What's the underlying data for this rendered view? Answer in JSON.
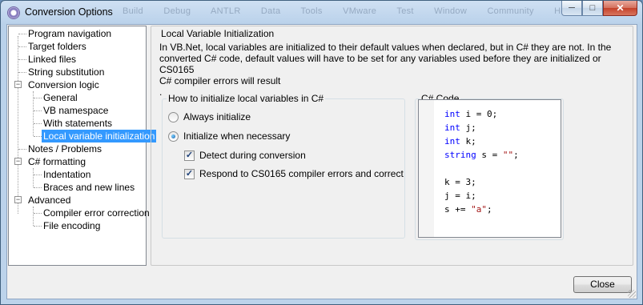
{
  "window": {
    "title": "Conversion Options",
    "background_menu": [
      "Build",
      "Debug",
      "ANTLR",
      "Data",
      "Tools",
      "VMware",
      "Test",
      "Window",
      "Community",
      "Help"
    ]
  },
  "tree": {
    "items": [
      {
        "label": "Program navigation"
      },
      {
        "label": "Target folders"
      },
      {
        "label": "Linked files"
      },
      {
        "label": "String substitution"
      },
      {
        "label": "Conversion logic"
      },
      {
        "label": "General"
      },
      {
        "label": "VB namespace"
      },
      {
        "label": "With statements"
      },
      {
        "label": "Local variable initialization"
      },
      {
        "label": "Notes / Problems"
      },
      {
        "label": "C# formatting"
      },
      {
        "label": "Indentation"
      },
      {
        "label": "Braces and new lines"
      },
      {
        "label": "Advanced"
      },
      {
        "label": "Compiler error correction"
      },
      {
        "label": "File encoding"
      }
    ],
    "selected": "Local variable initialization"
  },
  "panel": {
    "title": "Local Variable Initialization",
    "description_lines": [
      "In VB.Net, local variables are initialized to their default values when declared, but in C# they are not.  In the",
      "converted C# code, default values will have to be set for any variables used before they are initialized or CS0165",
      "C# compiler errors will result",
      "."
    ]
  },
  "init_group": {
    "title": "How to initialize local variables in C#",
    "always_label": "Always initialize",
    "necessary_label": "Initialize when necessary",
    "selected": "Initialize when necessary",
    "detect_label": "Detect during conversion",
    "detect_checked": true,
    "respond_label": "Respond to CS0165 compiler errors and correct",
    "respond_checked": true
  },
  "code_group": {
    "title": "C# Code",
    "lines": [
      [
        {
          "t": "int",
          "c": "kw"
        },
        {
          "t": " i = ",
          "c": ""
        },
        {
          "t": "0",
          "c": "num"
        },
        {
          "t": ";",
          "c": ""
        }
      ],
      [
        {
          "t": "int",
          "c": "kw"
        },
        {
          "t": " j;",
          "c": ""
        }
      ],
      [
        {
          "t": "int",
          "c": "kw"
        },
        {
          "t": " k;",
          "c": ""
        }
      ],
      [
        {
          "t": "string",
          "c": "kw"
        },
        {
          "t": " s = ",
          "c": ""
        },
        {
          "t": "\"\"",
          "c": "str"
        },
        {
          "t": ";",
          "c": ""
        }
      ],
      [],
      [
        {
          "t": "k = ",
          "c": ""
        },
        {
          "t": "3",
          "c": "num"
        },
        {
          "t": ";",
          "c": ""
        }
      ],
      [
        {
          "t": "j = i;",
          "c": ""
        }
      ],
      [
        {
          "t": "s += ",
          "c": ""
        },
        {
          "t": "\"a\"",
          "c": "str"
        },
        {
          "t": ";",
          "c": ""
        }
      ]
    ]
  },
  "footer": {
    "close_label": "Close"
  }
}
